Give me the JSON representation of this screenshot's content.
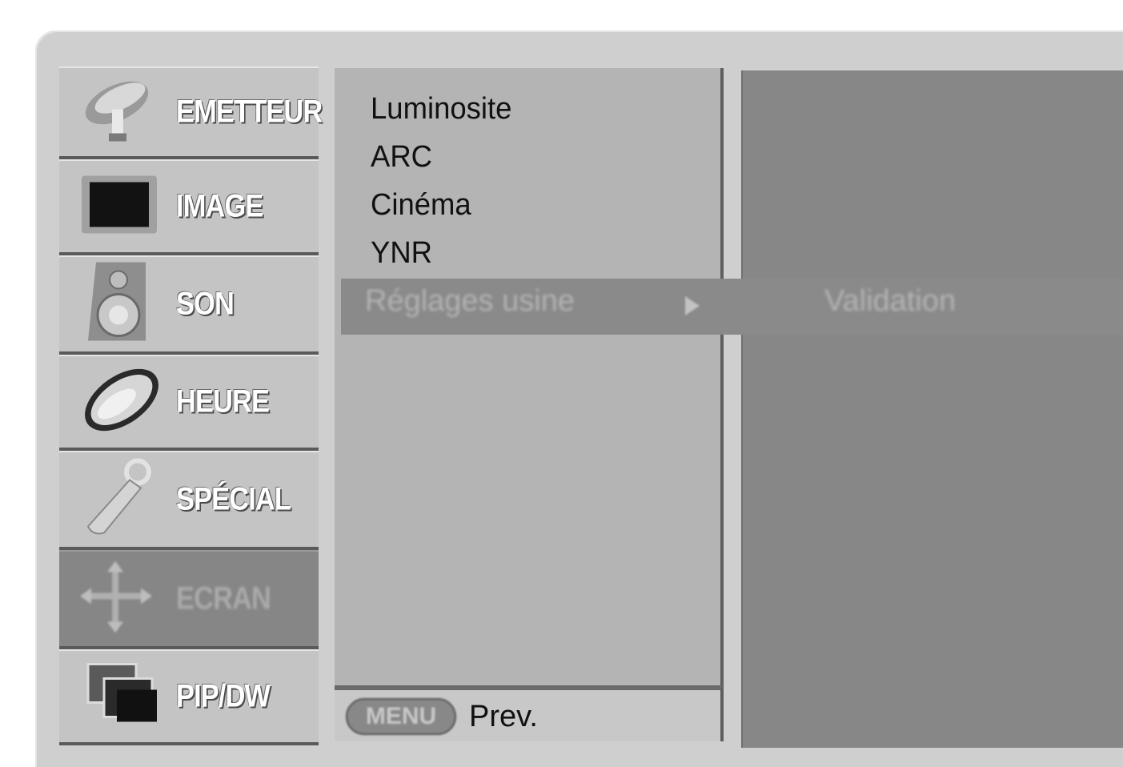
{
  "categories": [
    {
      "label": "EMETTEUR",
      "icon": "satellite-dish-icon",
      "selected": false
    },
    {
      "label": "IMAGE",
      "icon": "picture-icon",
      "selected": false
    },
    {
      "label": "SON",
      "icon": "speaker-icon",
      "selected": false
    },
    {
      "label": "HEURE",
      "icon": "clock-icon",
      "selected": false
    },
    {
      "label": "SPÉCIAL",
      "icon": "key-icon",
      "selected": false
    },
    {
      "label": "ECRAN",
      "icon": "screen-move-icon",
      "selected": true
    },
    {
      "label": "PIP/DW",
      "icon": "pip-icon",
      "selected": false
    }
  ],
  "submenu": {
    "items": [
      "Luminosite",
      "ARC",
      "Cinéma",
      "YNR"
    ],
    "highlighted_item": "Réglages usine",
    "highlighted_value": "Validation"
  },
  "footer": {
    "menu_key": "MENU",
    "prev_label": "Prev."
  },
  "colors": {
    "frame": "#cfcfcf",
    "menu_item": "#c4c4c4",
    "selected": "#868686",
    "submenu": "#b4b4b4",
    "panel": "#878787"
  }
}
